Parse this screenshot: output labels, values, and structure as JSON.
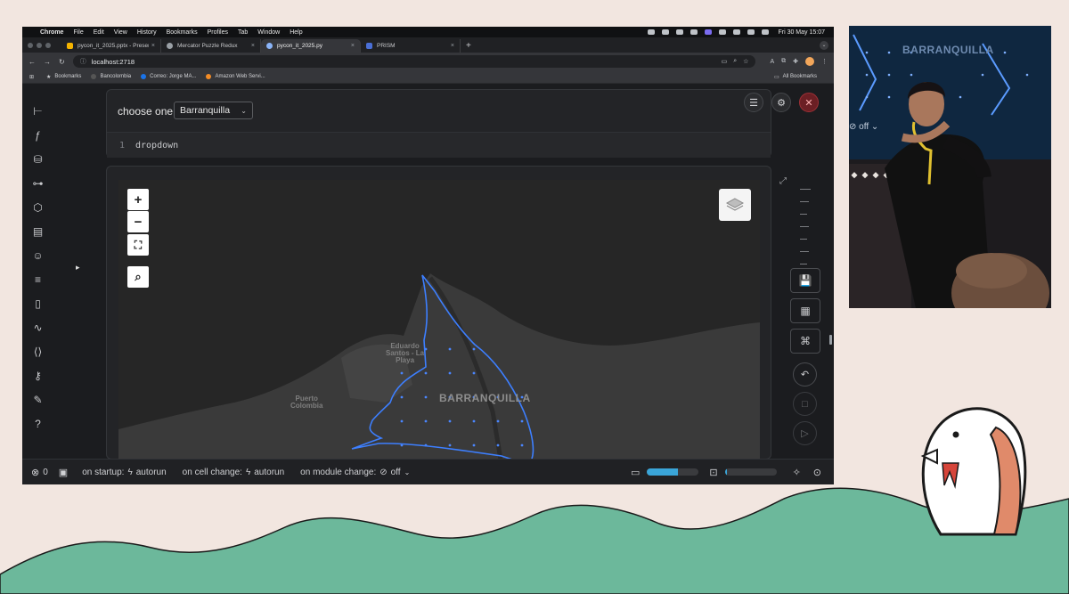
{
  "slide": {
    "colors": {
      "background": "#f2e6e0",
      "wave": "#6cb89b",
      "mascot_accent": "#e08a6a"
    }
  },
  "macos_menu": {
    "app": "Chrome",
    "items": [
      "File",
      "Edit",
      "View",
      "History",
      "Bookmarks",
      "Profiles",
      "Tab",
      "Window",
      "Help"
    ],
    "clock": "Fri 30 May 15:07"
  },
  "browser": {
    "tabs": [
      {
        "label": "pycon_it_2025.pptx - Presen",
        "color": "#f5b400",
        "active": false
      },
      {
        "label": "Mercator Puzzle Redux",
        "color": "#9aa0a6",
        "active": false
      },
      {
        "label": "pycon_it_2025.py",
        "color": "#8ab4f8",
        "active": true
      },
      {
        "label": "PRISM",
        "color": "#4a6fd6",
        "active": false
      }
    ],
    "url": "localhost:2718",
    "bookmarks": [
      {
        "label": "Bookmarks",
        "color": "#bfc3c8"
      },
      {
        "label": "Bancolombia",
        "color": "#444"
      },
      {
        "label": "Correo: Jorge MA...",
        "color": "#1a73e8"
      },
      {
        "label": "Amazon Web Servi...",
        "color": "#f28b25"
      }
    ],
    "all_bookmarks": "All Bookmarks"
  },
  "cell1": {
    "label": "choose one",
    "dropdown_value": "Barranquilla",
    "line_number": "1",
    "code": "dropdown"
  },
  "map": {
    "zoom_in": "+",
    "zoom_out": "−",
    "labels": {
      "eduardo_line1": "Eduardo",
      "eduardo_line2": "Santos - La",
      "eduardo_line3": "Playa",
      "puerto_line1": "Puerto",
      "puerto_line2": "Colombia",
      "city": "BARRANQUILLA"
    },
    "outline_color": "#3d7fff"
  },
  "footer": {
    "error_count": "0",
    "on_startup_label": "on startup:",
    "on_startup_value": "autorun",
    "on_cell_change_label": "on cell change:",
    "on_cell_change_value": "autorun",
    "on_module_change_label": "on module change:",
    "on_module_change_value": "off",
    "memory_fraction": 0.6,
    "cpu_fraction": 0.05
  },
  "webcam": {
    "screen_city": "BARRANQUILLA",
    "screen_toggle": "off"
  }
}
